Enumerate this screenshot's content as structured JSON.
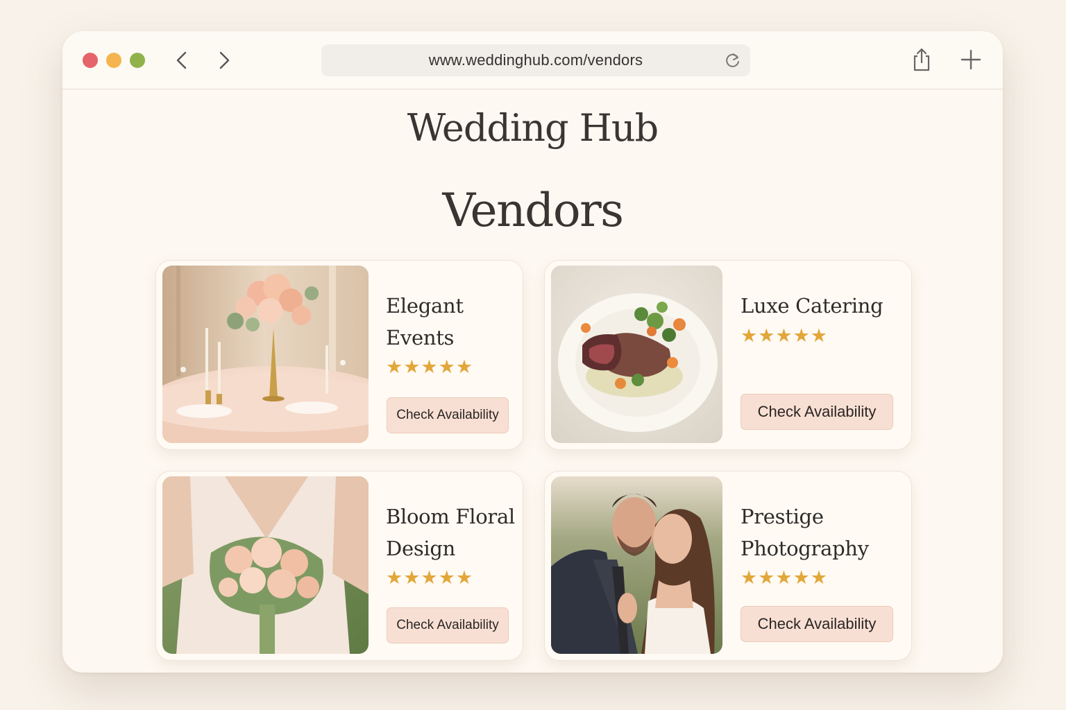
{
  "browser": {
    "url": "www.weddinghub.com/vendors",
    "icons": {
      "back": "chevron-left-icon",
      "forward": "chevron-right-icon",
      "reload": "reload-icon",
      "share": "share-icon",
      "new_tab": "plus-icon"
    }
  },
  "site": {
    "title": "Wedding Hub",
    "heading": "Vendors"
  },
  "vendors": [
    {
      "name": "Elegant Events",
      "stars": "★★★★★",
      "rating": 5,
      "cta": "Check Availability",
      "photo": "table-centerpiece"
    },
    {
      "name": "Luxe Catering",
      "stars": "★★★★★",
      "rating": 5,
      "cta": "Check Availability",
      "photo": "plated-dish"
    },
    {
      "name": "Bloom Floral Design",
      "stars": "★★★★★",
      "rating": 5,
      "cta": "Check Availability",
      "photo": "bridal-bouquet"
    },
    {
      "name": "Prestige Photography",
      "stars": "★★★★★",
      "rating": 5,
      "cta": "Check Availability",
      "photo": "couple-portrait"
    }
  ],
  "colors": {
    "background": "#f8f2ea",
    "window": "#fdf8f1",
    "button": "#f8dfd3",
    "star": "#e2a73a",
    "text": "#3a3532"
  }
}
